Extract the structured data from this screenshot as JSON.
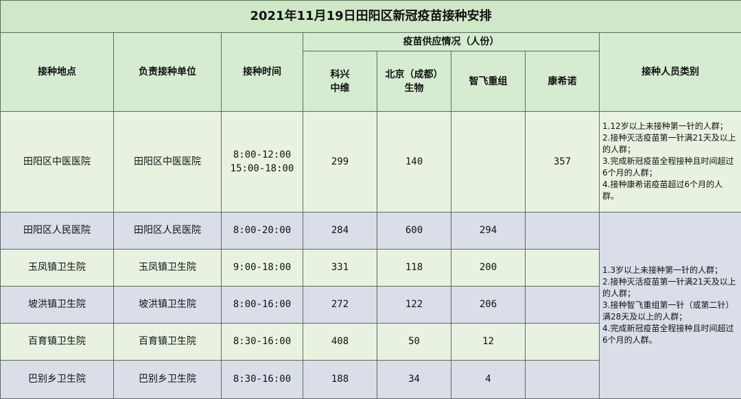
{
  "title": "2021年11月19日田阳区新冠疫苗接种安排",
  "headers": {
    "location": "接种地点",
    "unit": "负责接种单位",
    "time": "接种时间",
    "supply": "疫苗供应情况（人份）",
    "kexing": "科兴\n中维",
    "beijing": "北京（成都）\n生物",
    "zhifei": "智飞重组",
    "kangxinuo": "康希诺",
    "category": "接种人员类别"
  },
  "rows": [
    {
      "location": "田阳区中医医院",
      "unit": "田阳区中医医院",
      "time": "8:00-12:00\n15:00-18:00",
      "kexing": "299",
      "beijing": "140",
      "zhifei": "",
      "kangxinuo": "357"
    },
    {
      "location": "田阳区人民医院",
      "unit": "田阳区人民医院",
      "time": "8:00-20:00",
      "kexing": "284",
      "beijing": "600",
      "zhifei": "294",
      "kangxinuo": ""
    },
    {
      "location": "玉凤镇卫生院",
      "unit": "玉凤镇卫生院",
      "time": "9:00-18:00",
      "kexing": "331",
      "beijing": "118",
      "zhifei": "200",
      "kangxinuo": ""
    },
    {
      "location": "坡洪镇卫生院",
      "unit": "坡洪镇卫生院",
      "time": "8:00-16:00",
      "kexing": "272",
      "beijing": "122",
      "zhifei": "206",
      "kangxinuo": ""
    },
    {
      "location": "百育镇卫生院",
      "unit": "百育镇卫生院",
      "time": "8:30-16:00",
      "kexing": "408",
      "beijing": "50",
      "zhifei": "12",
      "kangxinuo": ""
    },
    {
      "location": "巴别乡卫生院",
      "unit": "巴别乡卫生院",
      "time": "8:30-16:00",
      "kexing": "188",
      "beijing": "34",
      "zhifei": "4",
      "kangxinuo": ""
    }
  ],
  "categories": {
    "group1": [
      "1.12岁以上未接种第一针的人群；",
      "2.接种灭活疫苗第一针满21天及以上的人群；",
      "3.完成新冠疫苗全程接种且时间超过6个月的人群；",
      "4.接种康希诺疫苗超过6个月的人群。"
    ],
    "group2": [
      "1.3岁以上未接种第一针的人群；",
      "2.接种灭活疫苗第一针满21天及以上的人群；",
      "3.接种智飞重组第一针（或第二针）满28天及以上的人群；",
      "4.完成新冠疫苗全程接种且时间超过6个月的人群。"
    ]
  },
  "colors": {
    "title_bg": "#cfe8c8",
    "header_bg": "#d6ecd1",
    "row_green": "#e8f2e1",
    "row_blue": "#d9dee9",
    "border": "#5b6b5b"
  }
}
